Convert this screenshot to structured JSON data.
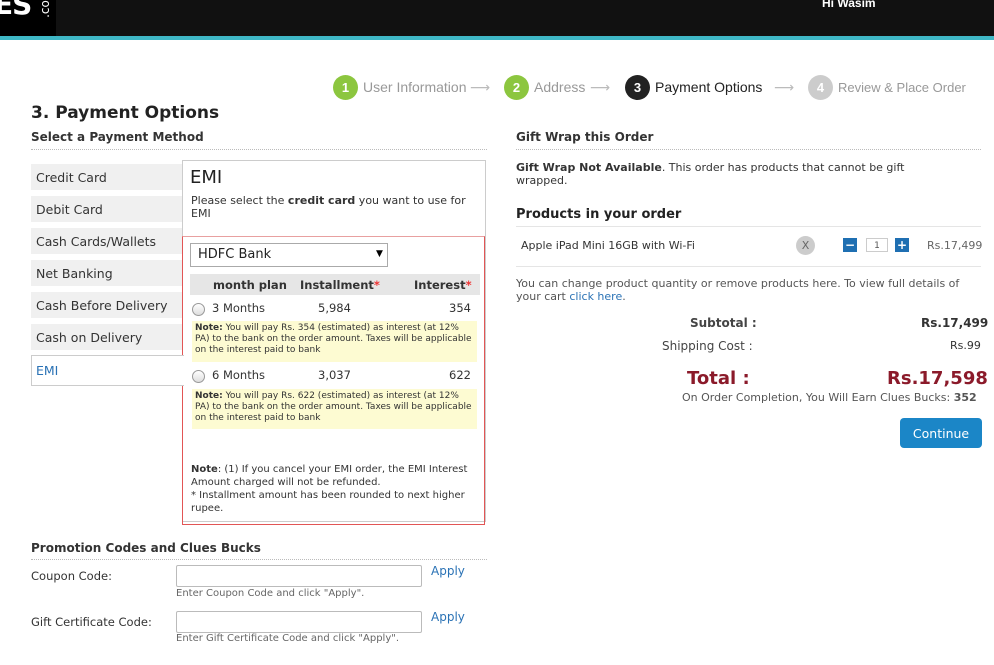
{
  "header": {
    "logo_text": "ES",
    "logo_sub": ".co",
    "greeting": "Hi Wasim",
    "accent_color": "#3fb8c6"
  },
  "steps": [
    {
      "num": "1",
      "label": "User Information",
      "state": "done",
      "color": "#8cc63f"
    },
    {
      "num": "2",
      "label": "Address",
      "state": "done",
      "color": "#8cc63f"
    },
    {
      "num": "3",
      "label": "Payment Options",
      "state": "current",
      "color": "#222222"
    },
    {
      "num": "4",
      "label": "Review & Place Order",
      "state": "pending",
      "color": "#cccccc"
    }
  ],
  "step_arrow": "⟶",
  "payment": {
    "title": "3. Payment  Options",
    "select_method": "Select a Payment Method",
    "methods": [
      {
        "label": "Credit Card"
      },
      {
        "label": "Debit Card"
      },
      {
        "label": "Cash Cards/Wallets"
      },
      {
        "label": "Net Banking"
      },
      {
        "label": "Cash Before Delivery"
      },
      {
        "label": "Cash on Delivery"
      },
      {
        "label": "EMI",
        "active": true
      }
    ]
  },
  "emi": {
    "title": "EMI",
    "desc_pre": "Please select the ",
    "desc_bold": "credit card",
    "desc_post": " you want to use for EMI",
    "bank_selected": "HDFC Bank",
    "caret": "▼",
    "headers": {
      "plan": "month plan",
      "installment": "Installment",
      "interest": "Interest",
      "req": "*"
    },
    "rows": [
      {
        "plan": "3 Months",
        "installment": "5,984",
        "interest": "354",
        "note_bold": "Note:",
        "note": " You will pay Rs. 354 (estimated) as interest (at 12% PA) to the bank on the order amount. Taxes will be applicable on the interest paid to bank"
      },
      {
        "plan": "6 Months",
        "installment": "3,037",
        "interest": "622",
        "note_bold": "Note:",
        "note": " You will pay Rs. 622 (estimated) as interest (at 12% PA) to the bank on the order amount. Taxes will be applicable on the interest paid to bank"
      }
    ],
    "footnote_bold": "Note",
    "footnote_1": ": (1) If you cancel your EMI order, the EMI Interest Amount charged will not be refunded.",
    "footnote_2": "* Installment amount has been rounded to next higher rupee."
  },
  "promo": {
    "title": "Promotion Codes and Clues Bucks",
    "coupon_label": "Coupon Code:",
    "coupon_value": "",
    "coupon_hint": "Enter Coupon Code and click \"Apply\".",
    "gift_label": "Gift Certificate Code:",
    "gift_value": "",
    "gift_hint": "Enter Gift Certificate Code and click \"Apply\".",
    "apply_label": "Apply"
  },
  "gift_wrap": {
    "title": "Gift Wrap this Order",
    "text_bold": "Gift Wrap Not Available",
    "text": ". This order has products that cannot be gift wrapped."
  },
  "products": {
    "title": "Products in your order",
    "items": [
      {
        "name": "Apple iPad Mini 16GB with Wi-Fi",
        "remove": "X",
        "qty": "1",
        "minus": "−",
        "plus": "+",
        "price": "Rs.17,499"
      }
    ],
    "change_text": "You can change product quantity or remove products here. To view full details of your cart ",
    "change_link": "click here",
    "change_end": "."
  },
  "summary": {
    "subtotal_label": "Subtotal :",
    "subtotal": "Rs.17,499",
    "shipping_label": "Shipping Cost :",
    "shipping": "Rs.99",
    "total_label": "Total :",
    "total": "Rs.17,598",
    "bucks_text": "On Order Completion, You Will Earn Clues Bucks: ",
    "bucks": "352",
    "total_color": "#8b1a2a"
  },
  "continue_label": "Continue"
}
